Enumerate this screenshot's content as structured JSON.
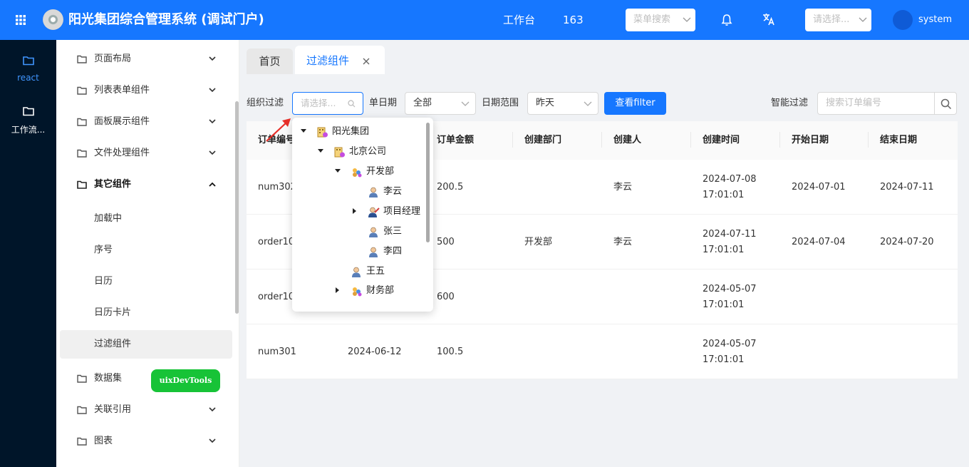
{
  "header": {
    "title": "阳光集团综合管理系统 (调试门户)",
    "workbench": "工作台",
    "count": "163",
    "menu_search_placeholder": "菜单搜索",
    "select_placeholder": "请选择...",
    "user": "system",
    "brand_color": "#1677ff"
  },
  "rail": {
    "items": [
      {
        "label": "react"
      },
      {
        "label": "工作流..."
      }
    ]
  },
  "sidebar": {
    "menus": [
      {
        "label": "页面布局"
      },
      {
        "label": "列表表单组件"
      },
      {
        "label": "面板展示组件"
      },
      {
        "label": "文件处理组件"
      },
      {
        "label": "其它组件"
      }
    ],
    "submenus": [
      "加载中",
      "序号",
      "日历",
      "日历卡片",
      "过滤组件"
    ],
    "menus_after": [
      {
        "label": "数据集"
      },
      {
        "label": "关联引用"
      },
      {
        "label": "图表"
      }
    ],
    "devtools": "uixDevTools"
  },
  "tabs": {
    "home": "首页",
    "active": "过滤组件"
  },
  "filters": {
    "org_label": "组织过滤",
    "org_placeholder": "请选择...",
    "date_label": "单日期",
    "date_value": "全部",
    "range_label": "日期范围",
    "range_value": "昨天",
    "query_button": "查看filter",
    "smart_label": "智能过滤",
    "smart_placeholder": "搜索订单编号"
  },
  "table": {
    "columns": [
      "订单编号",
      "",
      "订单金额",
      "创建部门",
      "创建人",
      "创建时间",
      "开始日期",
      "结束日期"
    ],
    "rows": [
      [
        "num302",
        "",
        "200.5",
        "",
        "李云",
        "2024-07-08\n17:01:01",
        "2024-07-01",
        "2024-07-11"
      ],
      [
        "order10",
        "",
        "500",
        "开发部",
        "李云",
        "2024-07-11\n17:01:01",
        "2024-07-04",
        "2024-07-20"
      ],
      [
        "order10",
        "",
        "600",
        "",
        "",
        "2024-05-07\n17:01:01",
        "",
        ""
      ],
      [
        "num301",
        "2024-06-12",
        "100.5",
        "",
        "",
        "2024-05-07\n17:01:01",
        "",
        ""
      ]
    ]
  },
  "tree": {
    "nodes": [
      {
        "label": "阳光集团",
        "icon": "org-icon"
      },
      {
        "label": "北京公司",
        "icon": "company-icon"
      },
      {
        "label": "开发部",
        "icon": "dept-icon"
      },
      {
        "label": "李云",
        "icon": "user-icon"
      },
      {
        "label": "项目经理",
        "icon": "role-icon"
      },
      {
        "label": "张三",
        "icon": "user-icon"
      },
      {
        "label": "李四",
        "icon": "user-icon"
      },
      {
        "label": "王五",
        "icon": "user-icon"
      },
      {
        "label": "财务部",
        "icon": "dept-icon"
      }
    ]
  }
}
